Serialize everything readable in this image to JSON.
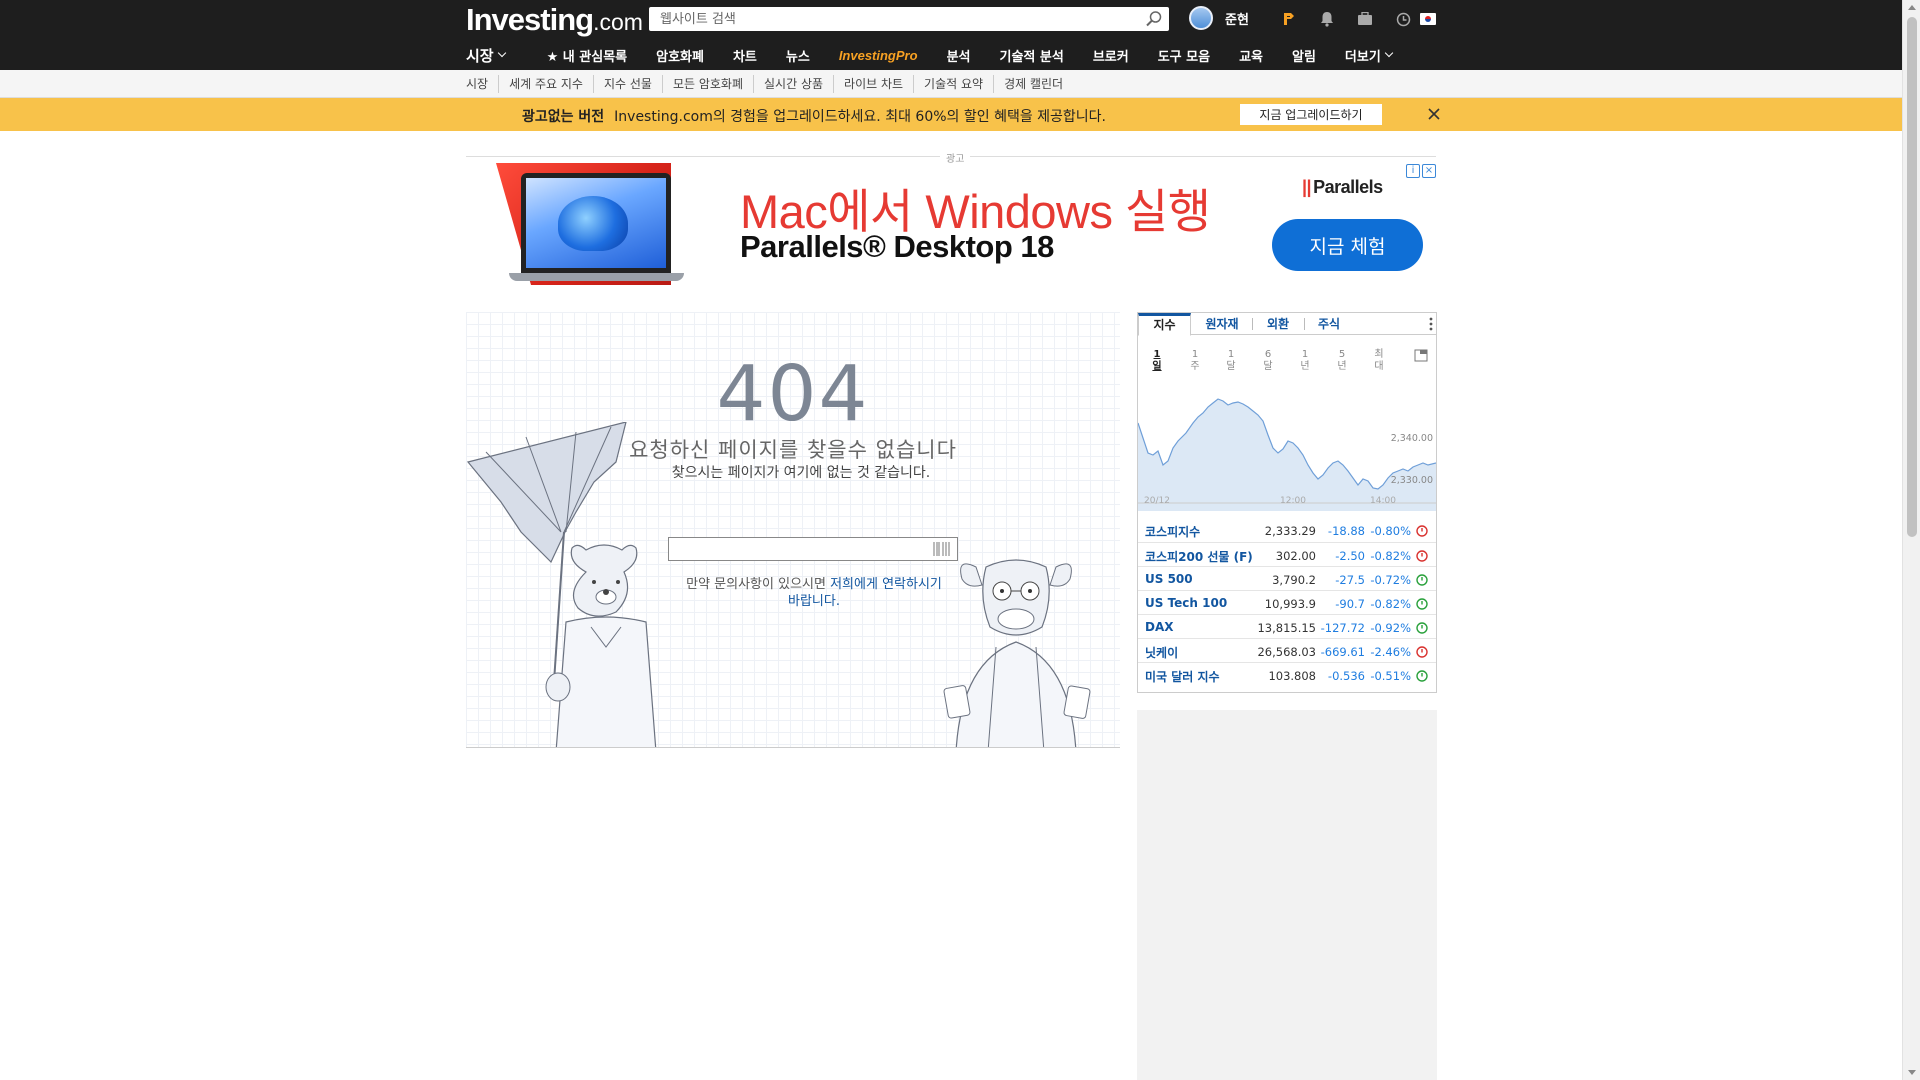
{
  "header": {
    "logo_main": "Investing",
    "logo_suffix": ".com",
    "search_placeholder": "웹사이트 검색",
    "user_name": "준현"
  },
  "nav": {
    "markets": "시장",
    "watchlist": "★ 내 관심목록",
    "crypto": "암호화폐",
    "charts": "차트",
    "news": "뉴스",
    "pro_a": "Investing",
    "pro_b": "Pro",
    "analysis": "분석",
    "technical": "기술적 분석",
    "brokers": "브로커",
    "tools": "도구 모음",
    "education": "교육",
    "alerts": "알림",
    "more": "더보기"
  },
  "subnav": [
    "시장",
    "세계 주요 지수",
    "지수 선물",
    "모든 암호화폐",
    "실시간 상품",
    "라이브 차트",
    "기술적 요약",
    "경제 캘린더"
  ],
  "promo": {
    "bold": "광고없는 버전",
    "text": "Investing.com의 경험을 업그레이드하세요. 최대 60%의 할인 혜택을 제공합니다.",
    "button": "지금 업그레이드하기"
  },
  "ad": {
    "label": "광고",
    "headline": "Mac에서 Windows 실행",
    "product": "Parallels® Desktop 18",
    "brand": "Parallels",
    "cta": "지금 체험"
  },
  "not_found": {
    "code": "404",
    "message": "요청하신 페이지를 찾을수 없습니다",
    "sub": "찾으시는 페이지가 여기에 없는 것 같습니다.",
    "contact_prefix": "만약 문의사항이 있으시면 ",
    "contact_link": "저희에게 연락하시기 바랍니다."
  },
  "widget": {
    "tabs": [
      "지수",
      "원자재",
      "외환",
      "주식"
    ],
    "periods": [
      [
        "1",
        "일"
      ],
      [
        "1",
        "주"
      ],
      [
        "1",
        "달"
      ],
      [
        "6",
        "달"
      ],
      [
        "1",
        "년"
      ],
      [
        "5",
        "년"
      ],
      [
        "최",
        "대"
      ]
    ],
    "chart": {
      "type": "area",
      "y_ticks": [
        "2,340.00",
        "2,330.00"
      ],
      "x_ticks": [
        "20/12",
        "12:00",
        "14:00"
      ]
    },
    "rows": [
      {
        "name": "코스피지수",
        "value": "2,333.29",
        "change": "-18.88",
        "pct": "-0.80%",
        "status": "closed"
      },
      {
        "name": "코스피200 선물 (F)",
        "value": "302.00",
        "change": "-2.50",
        "pct": "-0.82%",
        "status": "closed"
      },
      {
        "name": "US 500",
        "value": "3,790.2",
        "change": "-27.5",
        "pct": "-0.72%",
        "status": "open"
      },
      {
        "name": "US Tech 100",
        "value": "10,993.9",
        "change": "-90.7",
        "pct": "-0.82%",
        "status": "open"
      },
      {
        "name": "DAX",
        "value": "13,815.15",
        "change": "-127.72",
        "pct": "-0.92%",
        "status": "open"
      },
      {
        "name": "닛케이",
        "value": "26,568.03",
        "change": "-669.61",
        "pct": "-2.46%",
        "status": "closed"
      },
      {
        "name": "미국 달러 지수",
        "value": "103.808",
        "change": "-0.536",
        "pct": "-0.51%",
        "status": "open"
      }
    ]
  },
  "colors": {
    "header_bg": "#1e1e1e",
    "promo_bg": "#f8c24a",
    "link": "#1256a0",
    "ad_red": "#e63a33",
    "ad_blue": "#0f6fd6"
  }
}
